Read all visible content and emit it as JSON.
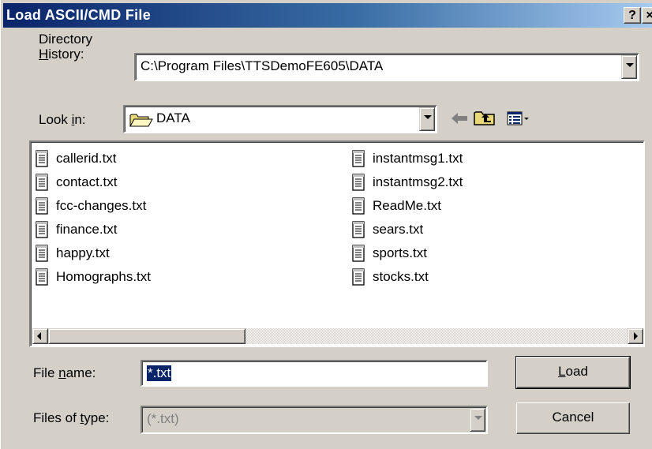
{
  "window": {
    "title": "Load ASCII/CMD File",
    "help_glyph": "?",
    "close_glyph": "×"
  },
  "directory_history": {
    "label_line1": "Directory",
    "label_line2_u": "H",
    "label_line2_rest": "istory:",
    "value": "C:\\Program Files\\TTSDemoFE605\\DATA"
  },
  "look_in": {
    "label_pre": "Look ",
    "label_u": "i",
    "label_post": "n:",
    "value": "DATA",
    "icon": "folder-icon"
  },
  "toolbar": {
    "back_icon": "back-arrow-icon",
    "up_icon": "up-folder-icon",
    "view_icon": "view-menu-icon"
  },
  "files": {
    "left": [
      "callerid.txt",
      "contact.txt",
      "fcc-changes.txt",
      "finance.txt",
      "happy.txt",
      "Homographs.txt"
    ],
    "right": [
      "instantmsg1.txt",
      "instantmsg2.txt",
      "ReadMe.txt",
      "sears.txt",
      "sports.txt",
      "stocks.txt"
    ],
    "icon": "text-file-icon"
  },
  "file_name": {
    "label_pre": "File ",
    "label_u": "n",
    "label_post": "ame:",
    "value": "*.txt"
  },
  "file_type": {
    "label_pre": "Files of ",
    "label_u": "t",
    "label_post": "ype:",
    "value": "(*.txt)"
  },
  "buttons": {
    "load_u": "L",
    "load_rest": "oad",
    "cancel": "Cancel"
  },
  "colors": {
    "titlebar_start": "#0a246a",
    "titlebar_end": "#a6caf0",
    "face": "#d4d0c8",
    "selection": "#0a246a"
  }
}
